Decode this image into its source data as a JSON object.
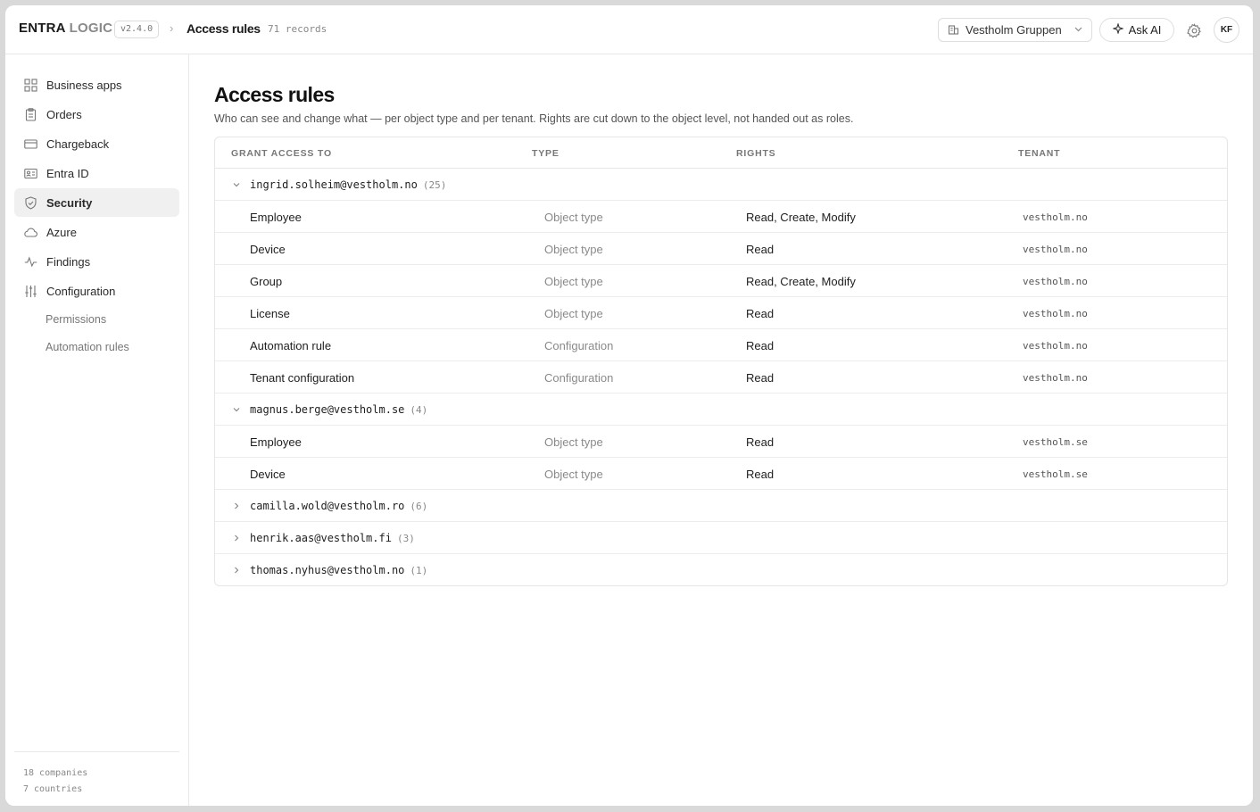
{
  "app": {
    "brand_main": "ENTRA",
    "brand_light": "LOGIC",
    "version": "v2.4.0",
    "breadcrumb_sep": "›",
    "page": "Access rules",
    "records": "71 records",
    "org": "Vestholm Gruppen",
    "ask_ai": "Ask AI",
    "avatar": "KF"
  },
  "sidebar": {
    "items": [
      {
        "label": "Business apps",
        "icon": "grid-icon"
      },
      {
        "label": "Orders",
        "icon": "clipboard-icon"
      },
      {
        "label": "Chargeback",
        "icon": "card-icon"
      },
      {
        "label": "Entra ID",
        "icon": "id-card-icon"
      },
      {
        "label": "Security",
        "icon": "shield-icon",
        "active": true
      },
      {
        "label": "Azure",
        "icon": "cloud-icon"
      },
      {
        "label": "Findings",
        "icon": "pulse-icon"
      },
      {
        "label": "Configuration",
        "icon": "sliders-icon"
      }
    ],
    "subitems": [
      {
        "label": "Permissions"
      },
      {
        "label": "Automation rules"
      }
    ],
    "footer": [
      "18 companies",
      "7 countries"
    ]
  },
  "main": {
    "title": "Access rules",
    "subtitle": "Who can see and change what — per object type and per tenant. Rights are cut down to the object level, not handed out as roles.",
    "columns": [
      "Grant access to",
      "Type",
      "Rights",
      "Tenant"
    ],
    "groups": [
      {
        "email": "ingrid.solheim@vestholm.no",
        "count": "(25)",
        "expanded": true,
        "rows": [
          {
            "name": "Employee",
            "type": "Object type",
            "rights": "Read, Create, Modify",
            "tenant": "vestholm.no"
          },
          {
            "name": "Device",
            "type": "Object type",
            "rights": "Read",
            "tenant": "vestholm.no"
          },
          {
            "name": "Group",
            "type": "Object type",
            "rights": "Read, Create, Modify",
            "tenant": "vestholm.no"
          },
          {
            "name": "License",
            "type": "Object type",
            "rights": "Read",
            "tenant": "vestholm.no"
          },
          {
            "name": "Automation rule",
            "type": "Configuration",
            "rights": "Read",
            "tenant": "vestholm.no"
          },
          {
            "name": "Tenant configuration",
            "type": "Configuration",
            "rights": "Read",
            "tenant": "vestholm.no"
          }
        ]
      },
      {
        "email": "magnus.berge@vestholm.se",
        "count": "(4)",
        "expanded": true,
        "rows": [
          {
            "name": "Employee",
            "type": "Object type",
            "rights": "Read",
            "tenant": "vestholm.se"
          },
          {
            "name": "Device",
            "type": "Object type",
            "rights": "Read",
            "tenant": "vestholm.se"
          }
        ]
      },
      {
        "email": "camilla.wold@vestholm.ro",
        "count": "(6)",
        "expanded": false,
        "rows": []
      },
      {
        "email": "henrik.aas@vestholm.fi",
        "count": "(3)",
        "expanded": false,
        "rows": []
      },
      {
        "email": "thomas.nyhus@vestholm.no",
        "count": "(1)",
        "expanded": false,
        "rows": []
      }
    ]
  }
}
